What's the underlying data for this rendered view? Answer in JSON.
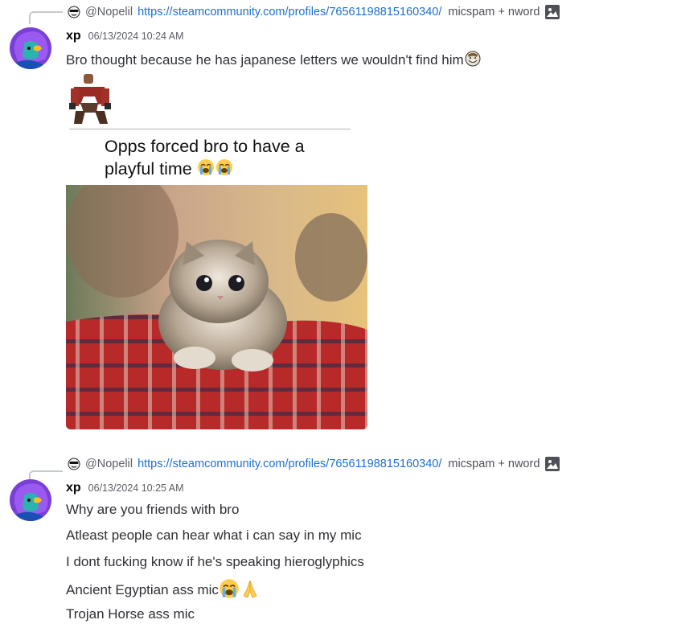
{
  "messages": [
    {
      "reply": {
        "name": "@Nopelil",
        "link": "https://steamcommunity.com/profiles/76561198815160340/",
        "text": "micspam + nword"
      },
      "username": "xp",
      "timestamp": "06/13/2024 10:24 AM",
      "lines": [
        "Bro thought because he has japanese letters we wouldn't find him"
      ],
      "embed_caption": "Opps forced bro to have a playful time"
    },
    {
      "reply": {
        "name": "@Nopelil",
        "link": "https://steamcommunity.com/profiles/76561198815160340/",
        "text": "micspam + nword"
      },
      "username": "xp",
      "timestamp": "06/13/2024 10:25 AM",
      "lines": [
        "Why are you friends with bro",
        "Atleast people can hear what i can say in my mic",
        "I dont fucking know if he's speaking hieroglyphics",
        "Ancient Egyptian ass mic",
        "Trojan Horse ass mic"
      ]
    }
  ],
  "icons": {
    "reply_avatar": "sunglasses-face-icon",
    "image_attachment": "image-icon",
    "trollface": "troll-face-emoji",
    "crying": "loudly-crying-emoji",
    "pray": "folded-hands-emoji"
  },
  "colors": {
    "link": "#1e6fd1",
    "text": "#2e3035",
    "muted": "#5c5e66"
  }
}
